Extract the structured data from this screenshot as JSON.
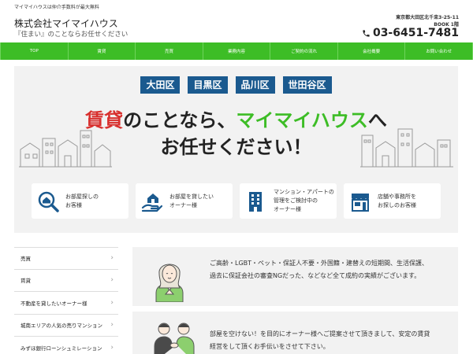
{
  "topbar": {
    "notice": "マイマイハウスは仲介手数料が最大無料"
  },
  "header": {
    "company": "株式会社マイマイハウス",
    "tagline": "『住まい』のことならお任せください",
    "address_line1": "東京都大田区北千束3-25-11",
    "address_line2": "BOOK 1階",
    "phone": "03-6451-7481"
  },
  "nav": {
    "items": [
      {
        "label": "TOP"
      },
      {
        "label": "賃貸"
      },
      {
        "label": "売買"
      },
      {
        "label": "業務内容"
      },
      {
        "label": "ご契約の流れ"
      },
      {
        "label": "会社概要"
      },
      {
        "label": "お問い合わせ"
      }
    ]
  },
  "hero": {
    "areas": [
      "大田区",
      "目黒区",
      "品川区",
      "世田谷区"
    ],
    "headline_part1_red": "賃貸",
    "headline_part1_rest": "のことなら、",
    "headline_part1_green": "マイマイハウス",
    "headline_part1_end": "へ",
    "headline_part2": "お任せください！",
    "cards": [
      {
        "icon": "house-search-icon",
        "line1": "お部屋探しの",
        "line2": "お客様",
        "line3": ""
      },
      {
        "icon": "hand-house-icon",
        "line1": "お部屋を貸したい",
        "line2": "オーナー様",
        "line3": ""
      },
      {
        "icon": "apartment-building-icon",
        "line1": "マンション・アパートの",
        "line2": "管理をご検討中の",
        "line3": "オーナー様"
      },
      {
        "icon": "storefront-icon",
        "line1": "店舗や事務所を",
        "line2": "お探しのお客様",
        "line3": ""
      }
    ]
  },
  "sidebar": {
    "items": [
      {
        "label": "売買"
      },
      {
        "label": "賃貸"
      },
      {
        "label": "不動産を貸したいオーナー様"
      },
      {
        "label": "城南エリアの人気の売りマンション"
      },
      {
        "label": "みずほ銀行ローンシュミレーション"
      }
    ]
  },
  "info": [
    {
      "icon": "woman-illustration-icon",
      "lines": [
        "ご高齢・LGBT・ペット・保証人不要・外国籍・建替えの短期間、生活保護、",
        "過去に保証会社の審査NGだった、などなど全て成約の実績がございます。"
      ]
    },
    {
      "icon": "handshake-illustration-icon",
      "lines": [
        "部屋を空けない！を目的にオーナー様へご提案させて頂きまして、安定の賃貸",
        "経営をして頂くお手伝いをさせて下さい。"
      ]
    }
  ],
  "colors": {
    "green": "#3dbd26",
    "navy": "#1b5a8f",
    "red": "#d8302e",
    "panel": "#f2f2f2"
  }
}
